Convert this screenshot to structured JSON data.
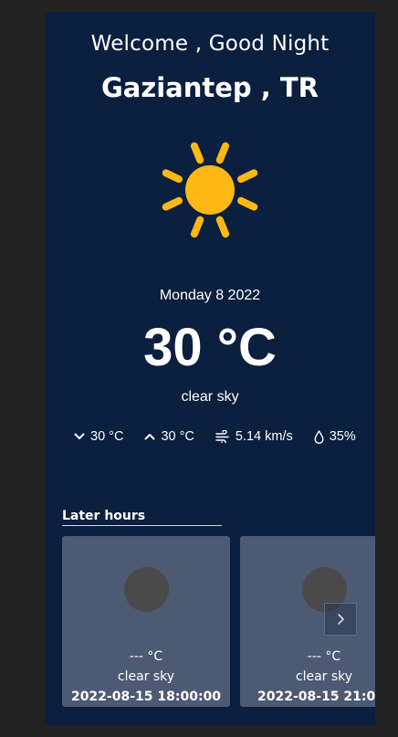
{
  "header": {
    "welcome": "Welcome , Good Night",
    "city": "Gaziantep , TR"
  },
  "current": {
    "icon": "sun-icon",
    "date": "Monday 8 2022",
    "temperature": "30 °C",
    "description": "clear sky",
    "stats": {
      "min_temp": "30 °C",
      "max_temp": "30 °C",
      "wind": "5.14 km/s",
      "humidity": "35%"
    }
  },
  "later": {
    "title": "Later hours",
    "cards": [
      {
        "temperature": "--- °C",
        "description": "clear sky",
        "time": "2022-08-15 18:00:00"
      },
      {
        "temperature": "--- °C",
        "description": "clear sky",
        "time": "2022-08-15 21:00:00"
      }
    ],
    "next_icon": "chevron-right-icon"
  },
  "colors": {
    "page_background": "#222222",
    "panel_background": "#0b1f3e",
    "card_background": "#4c5a73",
    "sun": "#fdb813"
  }
}
